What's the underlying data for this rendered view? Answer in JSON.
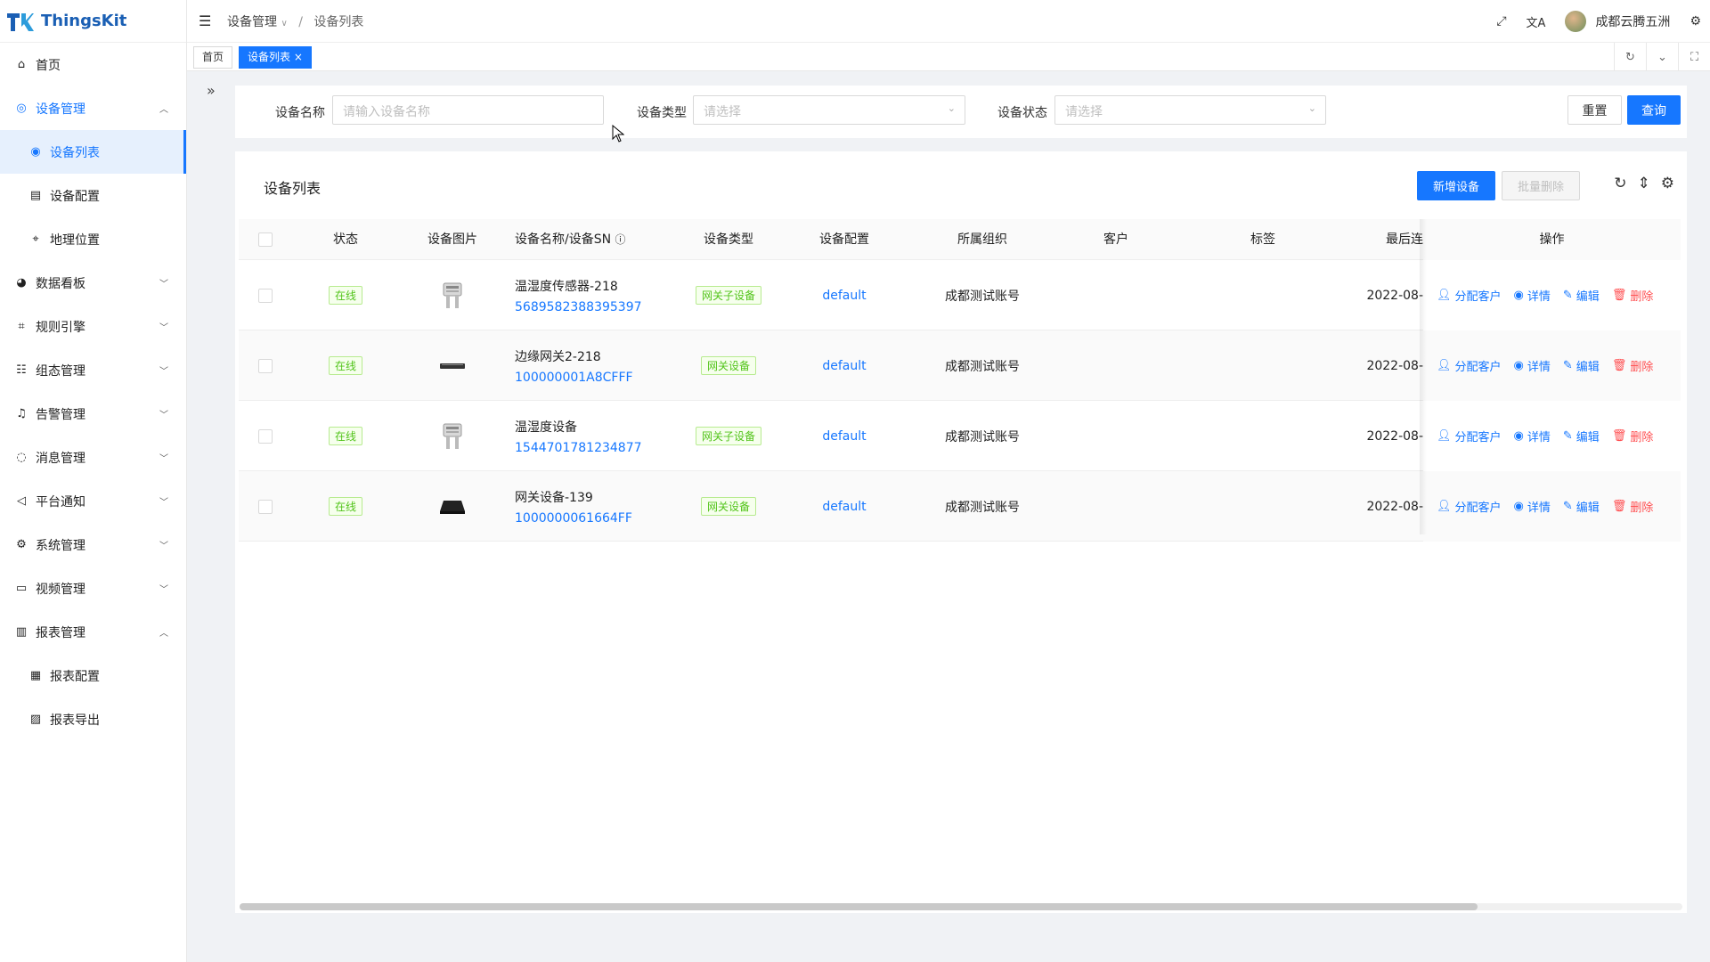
{
  "app": {
    "name": "ThingsKit"
  },
  "sidebar": {
    "items": [
      {
        "label": "首页",
        "icon": "home-icon"
      },
      {
        "label": "设备管理",
        "icon": "device-icon",
        "open": true
      },
      {
        "label": "设备列表",
        "icon": "list-icon",
        "sub": true,
        "active": true
      },
      {
        "label": "设备配置",
        "icon": "doc-icon",
        "sub": true
      },
      {
        "label": "地理位置",
        "icon": "location-icon",
        "sub": true
      },
      {
        "label": "数据看板",
        "icon": "dashboard-icon"
      },
      {
        "label": "规则引擎",
        "icon": "rule-icon"
      },
      {
        "label": "组态管理",
        "icon": "config-icon"
      },
      {
        "label": "告警管理",
        "icon": "alarm-icon"
      },
      {
        "label": "消息管理",
        "icon": "message-icon"
      },
      {
        "label": "平台通知",
        "icon": "notify-icon"
      },
      {
        "label": "系统管理",
        "icon": "settings-icon"
      },
      {
        "label": "视频管理",
        "icon": "video-icon"
      },
      {
        "label": "报表管理",
        "icon": "report-icon",
        "open": true
      },
      {
        "label": "报表配置",
        "icon": "report-config-icon",
        "sub": true
      },
      {
        "label": "报表导出",
        "icon": "report-export-icon",
        "sub": true
      }
    ]
  },
  "header": {
    "breadcrumb": [
      "设备管理",
      "设备列表"
    ],
    "user": "成都云腾五洲"
  },
  "tabs": [
    {
      "label": "首页"
    },
    {
      "label": "设备列表 ×"
    }
  ],
  "search": {
    "name_label": "设备名称",
    "name_placeholder": "请输入设备名称",
    "type_label": "设备类型",
    "type_placeholder": "请选择",
    "status_label": "设备状态",
    "status_placeholder": "请选择",
    "reset": "重置",
    "query": "查询"
  },
  "table": {
    "title": "设备列表",
    "add_button": "新增设备",
    "batch_delete": "批量删除",
    "columns": [
      "状态",
      "设备图片",
      "设备名称/设备SN",
      "设备类型",
      "设备配置",
      "所属组织",
      "客户",
      "标签",
      "最后连",
      "操作"
    ],
    "rows": [
      {
        "status": "在线",
        "name": "温湿度传感器-218",
        "sn": "5689582388395397",
        "type": "网关子设备",
        "config": "default",
        "org": "成都测试账号",
        "customer": "",
        "tags": "",
        "last": "2022-08-",
        "img": "sensor"
      },
      {
        "status": "在线",
        "name": "边缘网关2-218",
        "sn": "100000001A8CFFF",
        "type": "网关设备",
        "config": "default",
        "org": "成都测试账号",
        "customer": "",
        "tags": "",
        "last": "2022-08-",
        "img": "gateway-flat"
      },
      {
        "status": "在线",
        "name": "温湿度设备",
        "sn": "1544701781234877",
        "type": "网关子设备",
        "config": "default",
        "org": "成都测试账号",
        "customer": "",
        "tags": "",
        "last": "2022-08-",
        "img": "sensor"
      },
      {
        "status": "在线",
        "name": "网关设备-139",
        "sn": "1000000061664FF",
        "type": "网关设备",
        "config": "default",
        "org": "成都测试账号",
        "customer": "",
        "tags": "",
        "last": "2022-08-",
        "img": "gateway-box"
      }
    ],
    "actions": {
      "assign": "分配客户",
      "detail": "详情",
      "edit": "编辑",
      "delete": "删除"
    }
  }
}
